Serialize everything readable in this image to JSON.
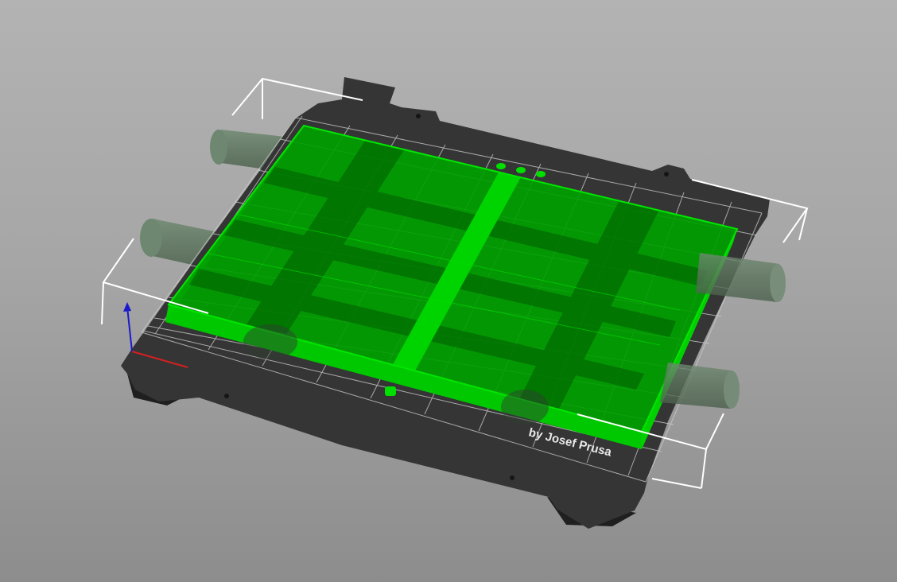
{
  "viewport": {
    "background_top": "#b3b3b3",
    "background_bottom": "#8d8d8d"
  },
  "bed": {
    "brand_text": "by Josef Prusa",
    "sheet_color": "#353535",
    "grid_color": "#cfcfcf"
  },
  "object": {
    "fill_color": "#00b400",
    "edge_color": "#00e600",
    "selected": true
  },
  "bounding_box": {
    "color": "#ffffff"
  },
  "axes": {
    "x_color": "#d42020",
    "z_color": "#1a1acc"
  },
  "icons": [
    "axis-gizmo-icon"
  ]
}
